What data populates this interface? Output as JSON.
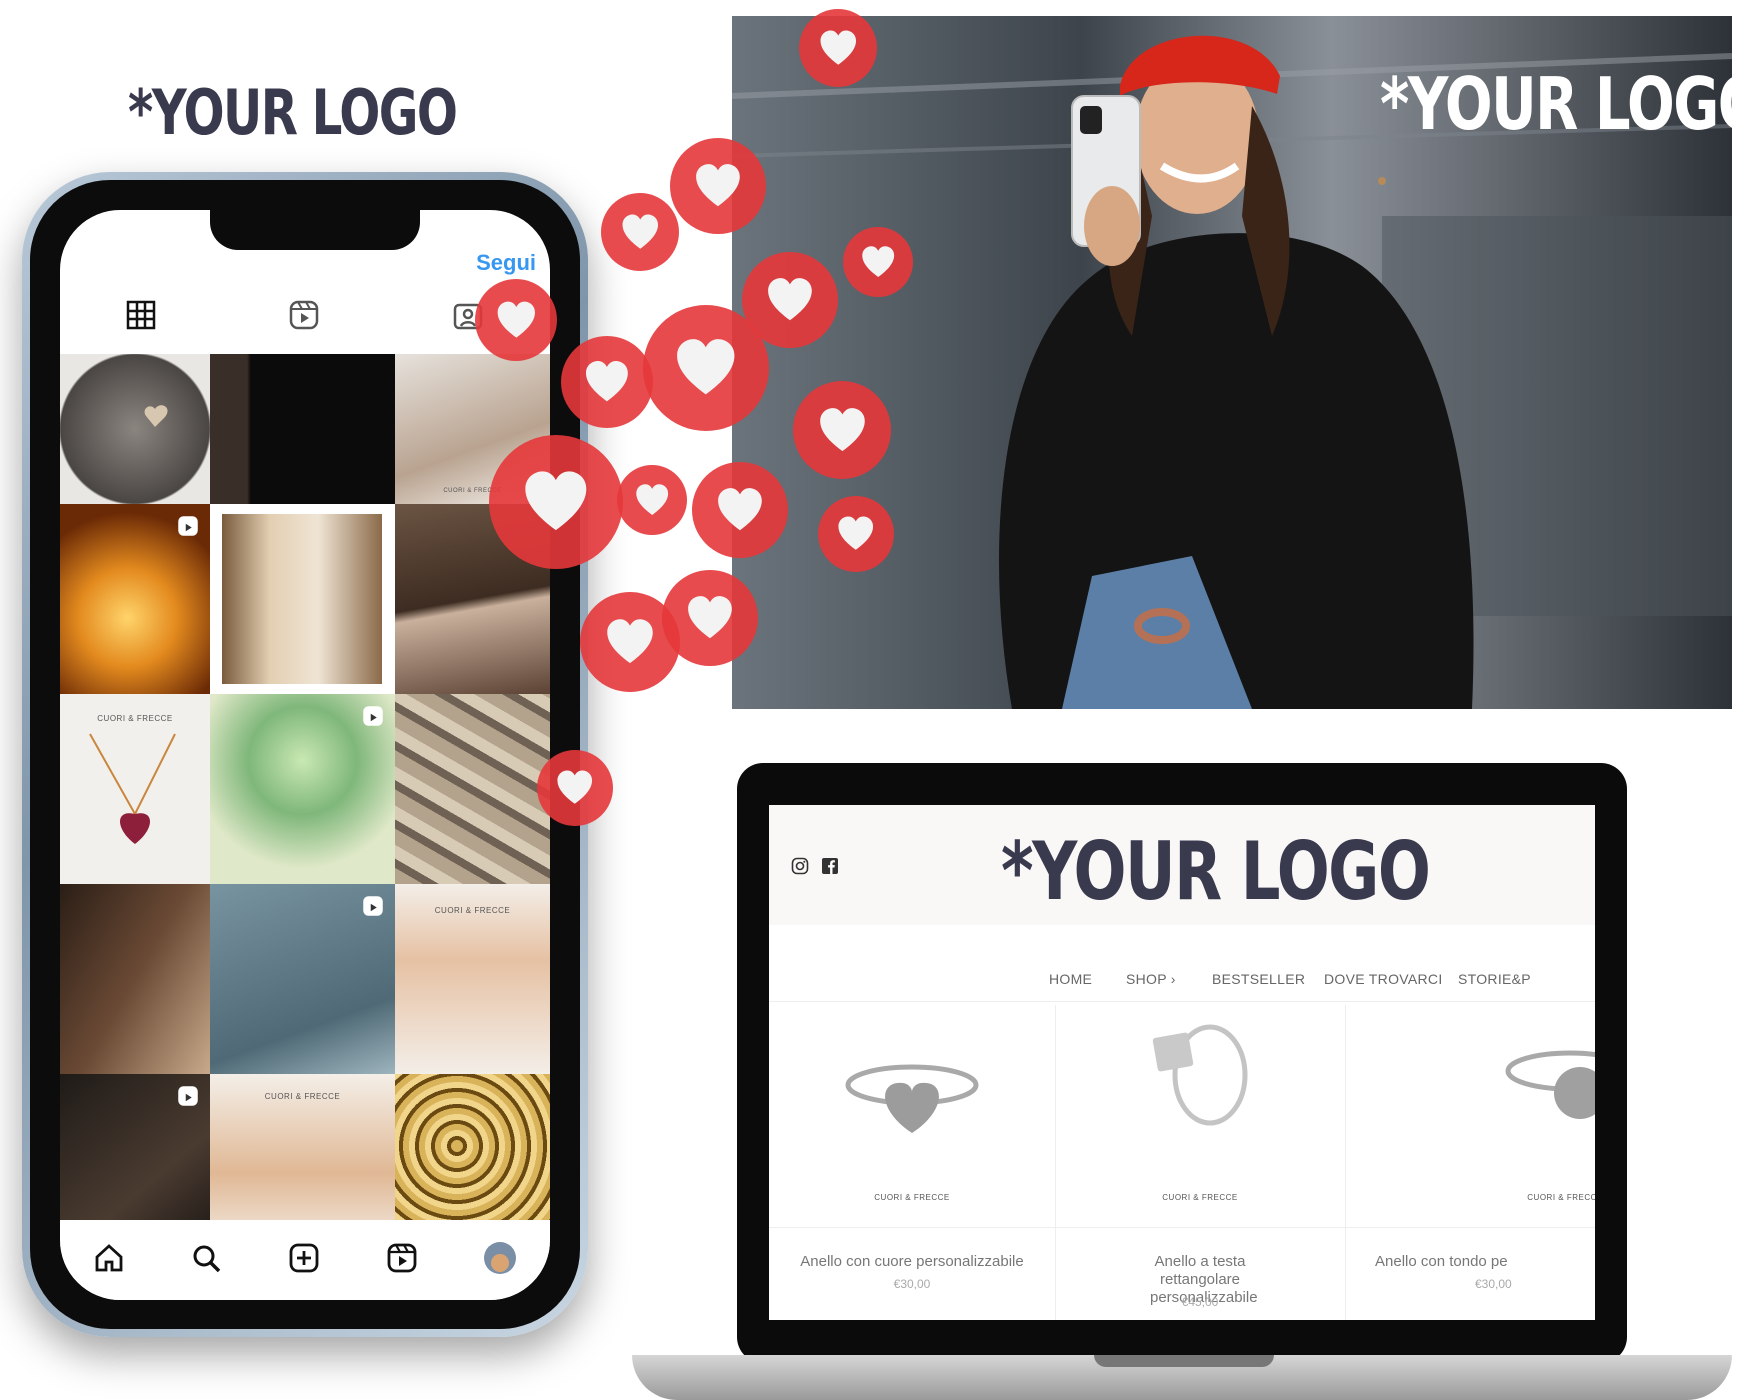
{
  "logo_text": "*YOUR LOGO",
  "colors": {
    "heart": "#e6373a",
    "logo_dark": "#3a3a4f",
    "link_blue": "#3897f0"
  },
  "phone": {
    "follow_label": "Segui",
    "tabs": [
      "grid-icon",
      "reels-tab-icon",
      "tagged-icon"
    ],
    "grid_brand_caption": "CUORI & FRECCE",
    "bottom_nav": [
      "home-icon",
      "search-icon",
      "add-post-icon",
      "reels-icon",
      "profile-avatar"
    ]
  },
  "website": {
    "social": [
      "instagram-icon",
      "facebook-icon"
    ],
    "nav": [
      "HOME",
      "SHOP ›",
      "BESTSELLER",
      "DOVE TROVARCI",
      "STORIE&P"
    ],
    "products": [
      {
        "brand": "CUORI & FRECCE",
        "name": "Anello con cuore personalizzabile",
        "price": "€30,00"
      },
      {
        "brand": "CUORI & FRECCE",
        "name": "Anello a testa rettangolare personalizzabile",
        "price": "€45,00"
      },
      {
        "brand": "CUORI & FRECCE",
        "name": "Anello con tondo pe",
        "price": "€30,00"
      }
    ]
  }
}
